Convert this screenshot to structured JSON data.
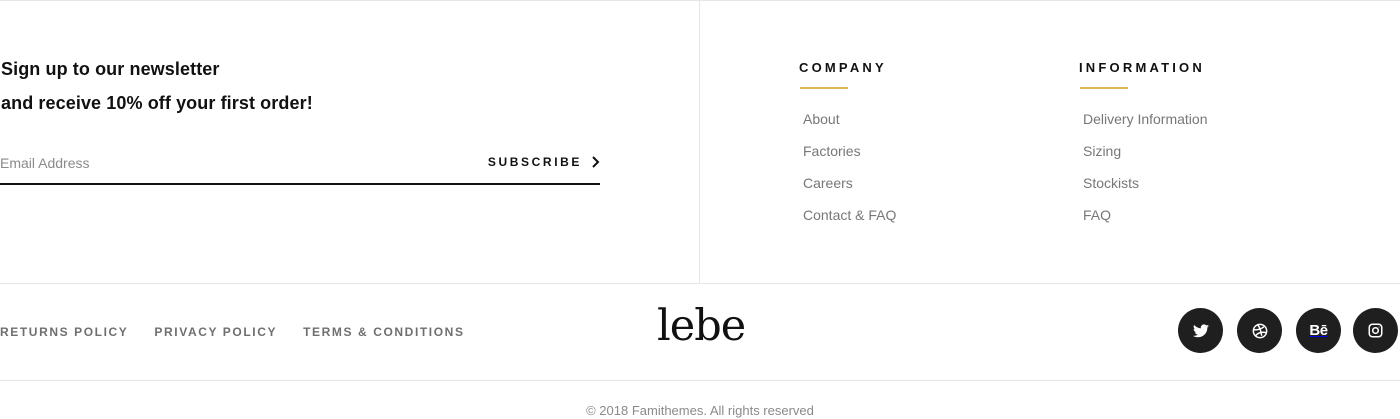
{
  "newsletter": {
    "line1": "Sign up to our newsletter",
    "line2": "and receive 10% off your first order!",
    "email_placeholder": "Email Address",
    "subscribe_label": "SUBSCRIBE",
    "subscribe_icon": "chevron-right-icon"
  },
  "columns": {
    "company": {
      "title": "COMPANY",
      "links": [
        "About",
        "Factories",
        "Careers",
        "Contact & FAQ"
      ]
    },
    "information": {
      "title": "INFORMATION",
      "links": [
        "Delivery Information",
        "Sizing",
        "Stockists",
        "FAQ"
      ]
    }
  },
  "bottom": {
    "policies": [
      "RETURNS POLICY",
      "PRIVACY POLICY",
      "TERMS & CONDITIONS"
    ],
    "logo": "lebe",
    "social": [
      {
        "icon": "twitter-icon"
      },
      {
        "icon": "dribbble-icon"
      },
      {
        "icon": "behance-icon",
        "text": "Bē"
      },
      {
        "icon": "instagram-icon"
      }
    ],
    "copyright": "© 2018 Famithemes. All rights reserved"
  },
  "colors": {
    "accent_underline": "#e2b857",
    "social_bg": "#1f1f1f",
    "link_gray": "#777777",
    "text_dark": "#111111"
  }
}
